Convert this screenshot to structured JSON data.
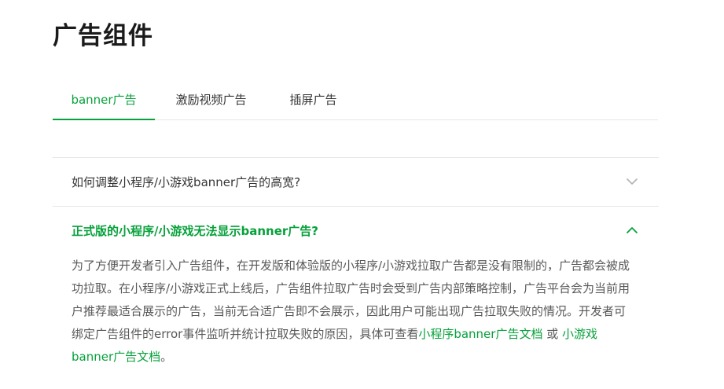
{
  "page": {
    "title": "广告组件"
  },
  "tabs": [
    {
      "label": "banner广告",
      "active": true
    },
    {
      "label": "激励视频广告",
      "active": false
    },
    {
      "label": "插屏广告",
      "active": false
    }
  ],
  "faq": {
    "items": [
      {
        "question": "如何调整小程序/小游戏banner广告的高宽?",
        "expanded": false
      },
      {
        "question": "正式版的小程序/小游戏无法显示banner广告?",
        "expanded": true,
        "answer": {
          "text": "为了方便开发者引入广告组件，在开发版和体验版的小程序/小游戏拉取广告都是没有限制的，广告都会被成功拉取。在小程序/小游戏正式上线后，广告组件拉取广告时会受到广告内部策略控制，广告平台会为当前用户推荐最适合展示的广告，当前无合适广告即不会展示，因此用户可能出现广告拉取失败的情况。开发者可绑定广告组件的error事件监听并统计拉取失败的原因，具体可查看",
          "link1": "小程序banner广告文档",
          "separator": " 或 ",
          "link2": "小游戏banner广告文档",
          "end": "。"
        }
      }
    ]
  },
  "colors": {
    "accent": "#07a13b",
    "text": "#353535",
    "divider": "#e6e6e6"
  },
  "icons": {
    "collapsed": "chevron-down-icon",
    "expanded": "chevron-up-icon"
  }
}
